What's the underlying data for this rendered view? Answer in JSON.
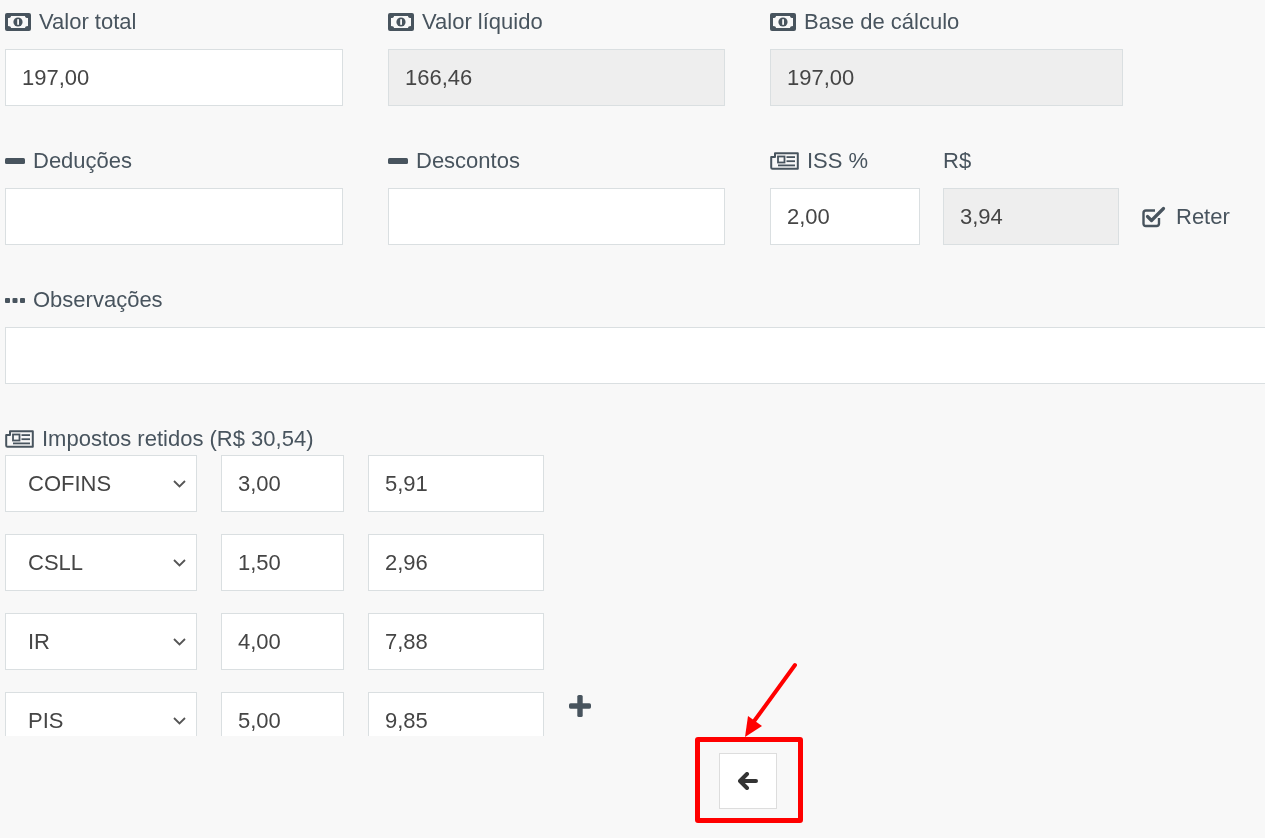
{
  "summary": [
    {
      "label": "Valor total",
      "value": "197,00",
      "disabled": false
    },
    {
      "label": "Valor líquido",
      "value": "166,46",
      "disabled": true
    },
    {
      "label": "Base de cálculo",
      "value": "197,00",
      "disabled": true
    }
  ],
  "adjustments": [
    {
      "label": "Deduções",
      "disabled": false
    },
    {
      "label": "Descontos",
      "disabled": false
    }
  ],
  "iss": {
    "label": "ISS %",
    "value": "2,00",
    "disabled": false,
    "amount_label": "R$",
    "amount": "3,94",
    "amount_disabled": true,
    "retain": {
      "label": "Reter",
      "checked": true
    }
  },
  "notes": {
    "label": "Observações"
  },
  "withheld_taxes": {
    "title": "Impostos retidos (R$ 30,54)",
    "rows": [
      {
        "tax": "COFINS",
        "rate": "3,00",
        "amount": "5,91"
      },
      {
        "tax": "CSLL",
        "rate": "1,50",
        "amount": "2,96"
      },
      {
        "tax": "IR",
        "rate": "4,00",
        "amount": "7,88"
      },
      {
        "tax": "PIS",
        "rate": "5,00",
        "amount": "9,85"
      }
    ]
  }
}
